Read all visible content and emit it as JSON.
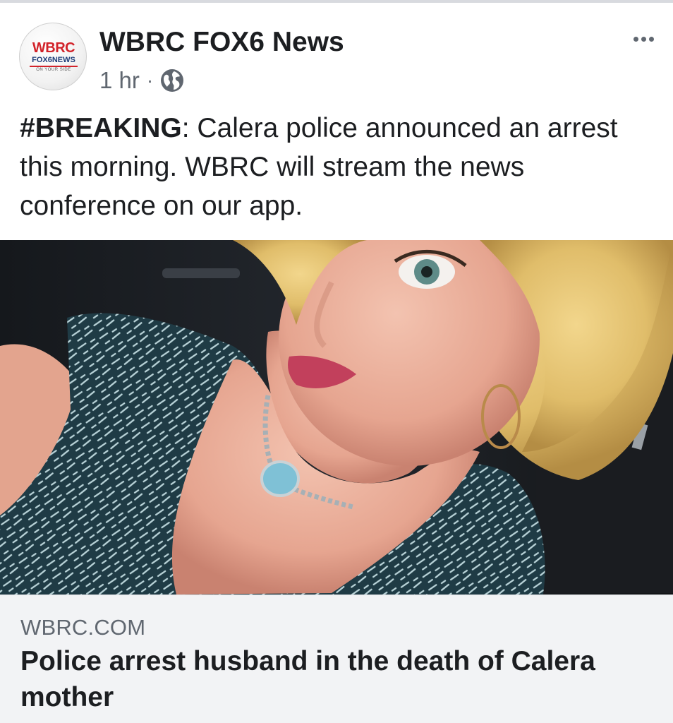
{
  "post": {
    "page_name": "WBRC FOX6 News",
    "avatar": {
      "logo_text": "WBRC",
      "logo_subtext": "FOX6NEWS",
      "logo_tagline": "ON YOUR SIDE"
    },
    "timestamp": "1 hr",
    "separator": "·",
    "audience_icon": "globe-icon",
    "more_icon": "more-options-icon",
    "text_hashtag": "#BREAKING",
    "text_body": ": Calera police announced an arrest this morning. WBRC will stream the news conference on our app."
  },
  "link_preview": {
    "domain": "WBRC.COM",
    "title": "Police arrest husband in the death of Calera mother"
  },
  "colors": {
    "text_primary": "#1c1e21",
    "text_secondary": "#606770",
    "preview_bg": "#f2f3f5",
    "brand_red": "#d2232a"
  }
}
